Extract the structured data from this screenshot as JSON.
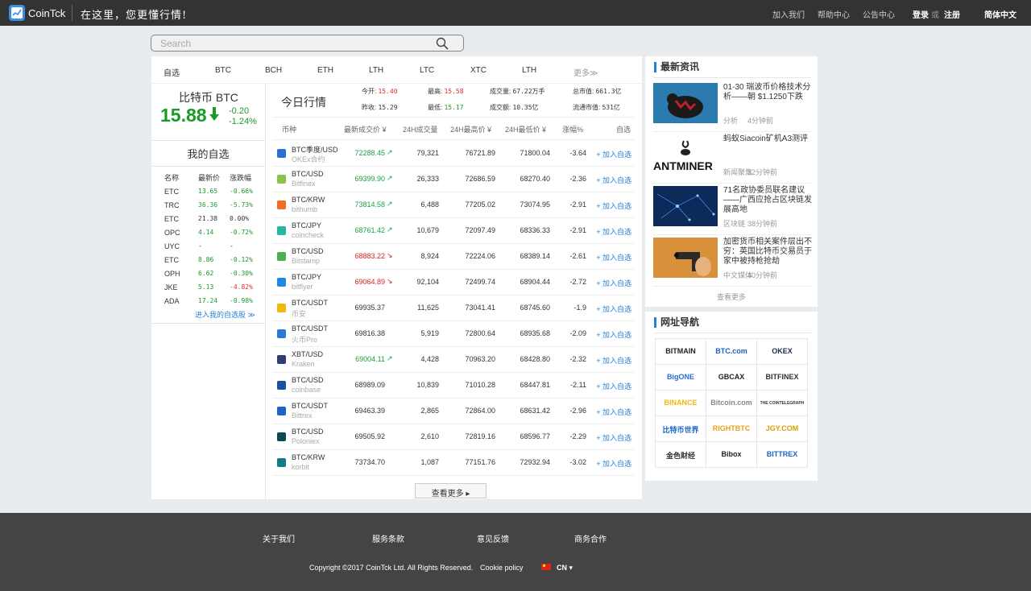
{
  "header": {
    "logo_text": "CoinTck",
    "slogan": "在这里，您更懂行情!",
    "nav": [
      "加入我们",
      "帮助中心",
      "公告中心"
    ],
    "login": "登录",
    "or": "或",
    "register": "注册",
    "language": "简体中文"
  },
  "search": {
    "placeholder": "Search"
  },
  "coin_tabs": [
    "自选",
    "BTC",
    "BCH",
    "ETH",
    "LTH",
    "LTC",
    "XTC",
    "LTH",
    "更多≫"
  ],
  "btc_summary": {
    "name": "比特币 BTC",
    "price": "15.88",
    "change": "-0.20",
    "change_pct": "-1.24%"
  },
  "watchlist": {
    "title": "我的自选",
    "headers": [
      "名称",
      "最新价",
      "涨跌幅"
    ],
    "rows": [
      {
        "name": "ETC",
        "price": "13.65",
        "chg": "-0.66%"
      },
      {
        "name": "TRC",
        "price": "36.36",
        "chg": "-5.73%"
      },
      {
        "name": "ETC",
        "price": "21.38",
        "chg": "0.00%"
      },
      {
        "name": "OPC",
        "price": "4.14",
        "chg": "-0.72%"
      },
      {
        "name": "UYC",
        "price": "-",
        "chg": "-"
      },
      {
        "name": "ETC",
        "price": "8.86",
        "chg": "-0.12%"
      },
      {
        "name": "OPH",
        "price": "6.62",
        "chg": "-0.30%"
      },
      {
        "name": "JKE",
        "price": "5.13",
        "chg": "-4.82%"
      },
      {
        "name": "ADA",
        "price": "17.24",
        "chg": "-0.98%"
      }
    ],
    "link": "进入我的自选股 ≫"
  },
  "today": {
    "title": "今日行情",
    "stats": [
      {
        "label": "今开:",
        "value": "15.40"
      },
      {
        "label": "最高:",
        "value": "15.58"
      },
      {
        "label": "成交量:",
        "value": "67.22万手"
      },
      {
        "label": "总市值:",
        "value": "661.3亿"
      },
      {
        "label": "昨收:",
        "value": "15.29"
      },
      {
        "label": "最低:",
        "value": "15.17"
      },
      {
        "label": "成交额:",
        "value": "10.35亿"
      },
      {
        "label": "流通市值:",
        "value": "531亿"
      }
    ]
  },
  "market_table": {
    "headers": [
      "币种",
      "最新成交价 ¥",
      "24H成交量",
      "24H最高价 ¥",
      "24H最低价 ¥",
      "涨幅%",
      "自选"
    ],
    "add_label": "+ 加入自选",
    "rows": [
      {
        "pair": "BTC季度/USD",
        "exchange": "OKEx合约",
        "price": "72288.45",
        "dir": "up",
        "vol": "79,321",
        "high": "76721.89",
        "low": "71800.04",
        "chg": "-3.64",
        "icon_color": "#2a6fd4"
      },
      {
        "pair": "BTC/USD",
        "exchange": "Bitfinex",
        "price": "69399.90",
        "dir": "up",
        "vol": "26,333",
        "high": "72686.59",
        "low": "68270.40",
        "chg": "-2.36",
        "icon_color": "#8bc34a"
      },
      {
        "pair": "BTC/KRW",
        "exchange": "bithumb",
        "price": "73814.58",
        "dir": "up",
        "vol": "6,488",
        "high": "77205.02",
        "low": "73074.95",
        "chg": "-2.91",
        "icon_color": "#f26d21"
      },
      {
        "pair": "BTC/JPY",
        "exchange": "coincheck",
        "price": "68761.42",
        "dir": "up",
        "vol": "10,679",
        "high": "72097.49",
        "low": "68336.33",
        "chg": "-2.91",
        "icon_color": "#27b6a4"
      },
      {
        "pair": "BTC/USD",
        "exchange": "Bitstamp",
        "price": "68883.22",
        "dir": "down",
        "vol": "8,924",
        "high": "72224.06",
        "low": "68389.14",
        "chg": "-2.61",
        "icon_color": "#4caf50"
      },
      {
        "pair": "BTC/JPY",
        "exchange": "bitflyer",
        "price": "69064.89",
        "dir": "down",
        "vol": "92,104",
        "high": "72499.74",
        "low": "68904.44",
        "chg": "-2.72",
        "icon_color": "#1e88e5"
      },
      {
        "pair": "BTC/USDT",
        "exchange": "币安",
        "price": "69935.37",
        "dir": "none",
        "vol": "11,625",
        "high": "73041.41",
        "low": "68745.60",
        "chg": "-1.9",
        "icon_color": "#f0b90b"
      },
      {
        "pair": "BTC/USDT",
        "exchange": "火币Pro",
        "price": "69816.38",
        "dir": "none",
        "vol": "5,919",
        "high": "72800.64",
        "low": "68935.68",
        "chg": "-2.09",
        "icon_color": "#2b7bd4"
      },
      {
        "pair": "XBT/USD",
        "exchange": "Kraken",
        "price": "69004.11",
        "dir": "up",
        "vol": "4,428",
        "high": "70963.20",
        "low": "68428.80",
        "chg": "-2.32",
        "icon_color": "#2f3e73"
      },
      {
        "pair": "BTC/USD",
        "exchange": "coinbase",
        "price": "68989.09",
        "dir": "none",
        "vol": "10,839",
        "high": "71010.28",
        "low": "68447.81",
        "chg": "-2.11",
        "icon_color": "#1652a0"
      },
      {
        "pair": "BTC/USDT",
        "exchange": "Bittrex",
        "price": "69463.39",
        "dir": "none",
        "vol": "2,865",
        "high": "72864.00",
        "low": "68631.42",
        "chg": "-2.96",
        "icon_color": "#1e64c8"
      },
      {
        "pair": "BTC/USD",
        "exchange": "Poloniex",
        "price": "69505.92",
        "dir": "none",
        "vol": "2,610",
        "high": "72819.16",
        "low": "68596.77",
        "chg": "-2.29",
        "icon_color": "#0b4a55"
      },
      {
        "pair": "BTC/KRW",
        "exchange": "korbit",
        "price": "73734.70",
        "dir": "none",
        "vol": "1,087",
        "high": "77151.76",
        "low": "72932.94",
        "chg": "-3.02",
        "icon_color": "#137a8a"
      }
    ],
    "see_more": "查看更多 ▸"
  },
  "news": {
    "title": "最新资讯",
    "items": [
      {
        "title": "01-30 瑞波币价格技术分析——朝 $1.1250下跌",
        "source": "分析",
        "time": "4分钟前"
      },
      {
        "title": "蚂蚁Siacoin矿机A3测评",
        "source": "新闻聚焦",
        "time": "32分钟前"
      },
      {
        "title": "71名政协委员联名建议——广西应抢占区块链发展高地",
        "source": "区块链",
        "time": "38分钟前"
      },
      {
        "title": "加密货币相关案件层出不穷：英国比特币交易员于家中被持枪抢劫",
        "source": "中文媒体",
        "time": "40分钟前"
      }
    ],
    "more": "查看更多",
    "img_text": "ANTMINER"
  },
  "site_nav": {
    "title": "网址导航",
    "logos": [
      {
        "label": "BITMAIN",
        "color": "#222"
      },
      {
        "label": "BTC.com",
        "color": "#1a63c6"
      },
      {
        "label": "OKEX",
        "color": "#1d2a4d"
      },
      {
        "label": "BigONE",
        "color": "#2a6fd4"
      },
      {
        "label": "GBCAX",
        "color": "#222"
      },
      {
        "label": "BITFINEX",
        "color": "#333"
      },
      {
        "label": "BINANCE",
        "color": "#f0b90b"
      },
      {
        "label": "Bitcoin.com",
        "color": "#888"
      },
      {
        "label": "THE COINTELEGRAPH",
        "color": "#333"
      },
      {
        "label": "比特币世界",
        "color": "#1a63c6"
      },
      {
        "label": "RIGHTBTC",
        "color": "#e5a11b"
      },
      {
        "label": "JGY.COM",
        "color": "#d8a000"
      },
      {
        "label": "金色财经",
        "color": "#333"
      },
      {
        "label": "Bibox",
        "color": "#222"
      },
      {
        "label": "BITTREX",
        "color": "#1e64c8"
      }
    ]
  },
  "footer": {
    "links": [
      "关于我们",
      "服务条款",
      "意见反馈",
      "商务合作"
    ],
    "copyright": "Copyright ©2017 CoinTck Ltd. All Rights Reserved.",
    "cookie": "Cookie policy",
    "lang": "CN ▾"
  }
}
